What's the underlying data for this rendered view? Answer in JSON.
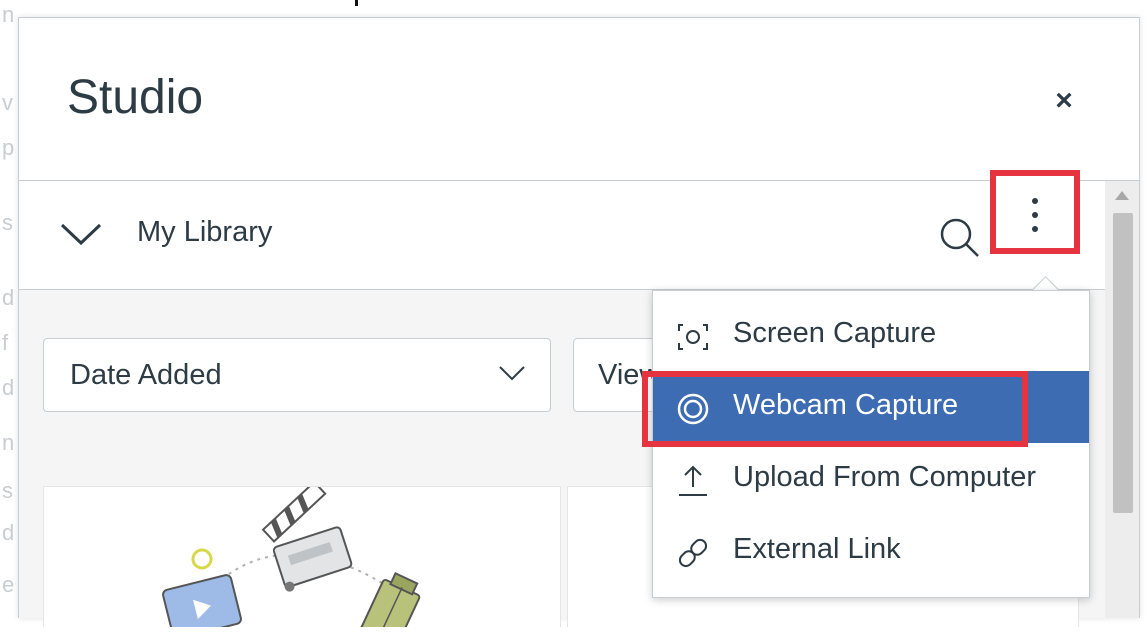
{
  "modal": {
    "title": "Studio",
    "close_label": "×"
  },
  "toolbar": {
    "library_label": "My Library"
  },
  "filters": {
    "sort_value": "Date Added",
    "view_value": "View"
  },
  "menu": {
    "items": [
      {
        "label": "Screen Capture",
        "icon": "screen-capture-icon"
      },
      {
        "label": "Webcam Capture",
        "icon": "webcam-icon",
        "active": true
      },
      {
        "label": "Upload From Computer",
        "icon": "upload-icon"
      },
      {
        "label": "External Link",
        "icon": "link-icon"
      }
    ]
  },
  "colors": {
    "accent": "#3d6cb3",
    "highlight": "#e63340",
    "text": "#2d3b45"
  }
}
